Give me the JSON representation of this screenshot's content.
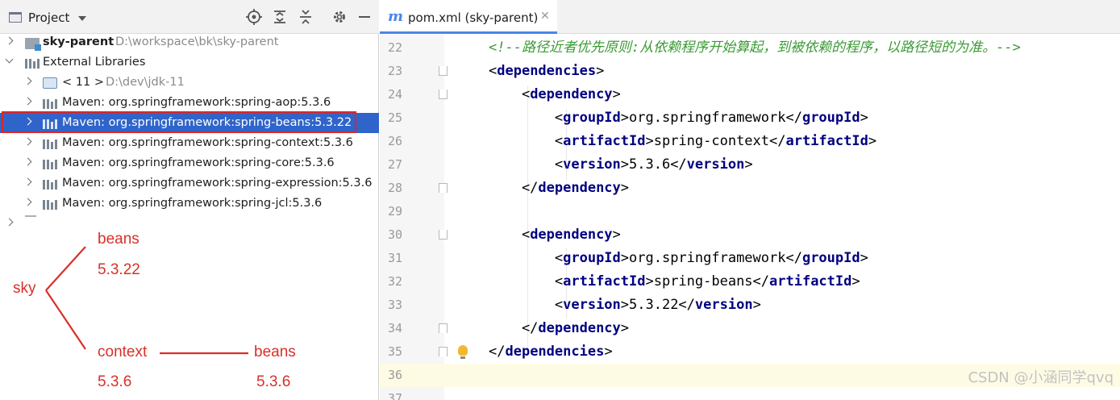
{
  "project_panel": {
    "title": "Project",
    "tree": [
      {
        "label": "sky-parent",
        "path": "D:\\workspace\\bk\\sky-parent"
      },
      {
        "label": "External Libraries"
      },
      {
        "label": "< 11 >",
        "path": "D:\\dev\\jdk-11"
      },
      {
        "label": "Maven: org.springframework:spring-aop:5.3.6"
      },
      {
        "label": "Maven: org.springframework:spring-beans:5.3.22"
      },
      {
        "label": "Maven: org.springframework:spring-context:5.3.6"
      },
      {
        "label": "Maven: org.springframework:spring-core:5.3.6"
      },
      {
        "label": "Maven: org.springframework:spring-expression:5.3.6"
      },
      {
        "label": "Maven: org.springframework:spring-jcl:5.3.6"
      }
    ]
  },
  "annotation": {
    "root": "sky",
    "upper_name": "beans",
    "upper_version": "5.3.22",
    "lower_name": "context",
    "lower_version": "5.3.6",
    "lower_child_name": "beans",
    "lower_child_version": "5.3.6",
    "color": "#d8302a"
  },
  "editor": {
    "tab_label": "pom.xml (sky-parent)",
    "lines": [
      {
        "n": "22",
        "comment": "<!--路径近者优先原则:从依赖程序开始算起，到被依赖的程序，以路径短的为准。-->"
      },
      {
        "n": "23",
        "tag": "dependencies"
      },
      {
        "n": "24",
        "tag": "dependency"
      },
      {
        "n": "25",
        "tag": "groupId",
        "value": "org.springframework"
      },
      {
        "n": "26",
        "tag": "artifactId",
        "value": "spring-context"
      },
      {
        "n": "27",
        "tag": "version",
        "value": "5.3.6"
      },
      {
        "n": "28",
        "tag": "dependency"
      },
      {
        "n": "29"
      },
      {
        "n": "30",
        "tag": "dependency"
      },
      {
        "n": "31",
        "tag": "groupId",
        "value": "org.springframework"
      },
      {
        "n": "32",
        "tag": "artifactId",
        "value": "spring-beans"
      },
      {
        "n": "33",
        "tag": "version",
        "value": "5.3.22"
      },
      {
        "n": "34",
        "tag": "dependency"
      },
      {
        "n": "35",
        "tag": "dependencies"
      },
      {
        "n": "36"
      },
      {
        "n": "37"
      }
    ]
  },
  "watermark": "CSDN @小涵同学qvq"
}
